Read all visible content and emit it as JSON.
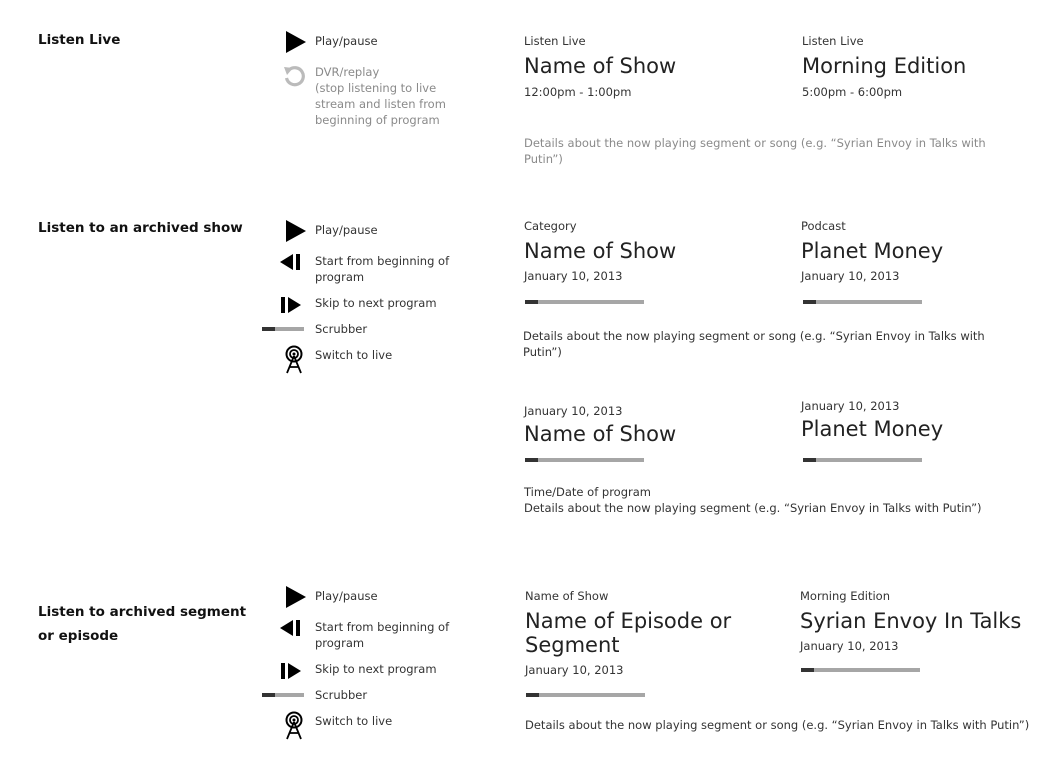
{
  "sections": {
    "live": {
      "title": "Listen Live"
    },
    "archived_show": {
      "title": "Listen to an archived show"
    },
    "archived_segment": {
      "title_line1": "Listen to archived segment",
      "title_line2": "or episode"
    }
  },
  "legend": {
    "play_pause": "Play/pause",
    "dvr_line1": "DVR/replay",
    "dvr_line2": "(stop listening to live",
    "dvr_line3": "stream and listen from",
    "dvr_line4": "beginning of program",
    "start_line1": "Start from beginning of",
    "start_line2": "program",
    "skip": "Skip to next program",
    "scrubber": "Scrubber",
    "switch_live": "Switch to live"
  },
  "live_cards": [
    {
      "label": "Listen Live",
      "title": "Name of Show",
      "time": "12:00pm - 1:00pm"
    },
    {
      "label": "Listen Live",
      "title": "Morning Edition",
      "time": "5:00pm - 6:00pm"
    }
  ],
  "live_details": "Details about the now playing segment or song (e.g. “Syrian Envoy in Talks with Putin”)",
  "archived_cards": [
    {
      "label": "Category",
      "title": "Name of Show",
      "date": "January 10, 2013",
      "progress": 0.11
    },
    {
      "label": "Podcast",
      "title": "Planet Money",
      "date": "January 10, 2013",
      "progress": 0.11
    }
  ],
  "archived_details": "Details about the now playing segment or song (e.g. “Syrian Envoy in Talks with Putin”)",
  "archived_alt_cards": [
    {
      "date": "January 10, 2013",
      "title": "Name of Show",
      "progress": 0.11
    },
    {
      "date": "January 10, 2013",
      "title": "Planet Money",
      "progress": 0.11
    }
  ],
  "archived_alt_details": {
    "line1": "Time/Date of program",
    "line2": "Details about the now playing segment (e.g. “Syrian Envoy in Talks with Putin”)"
  },
  "segment_cards": [
    {
      "label": "Name of Show",
      "title_line1": "Name of Episode or",
      "title_line2": "Segment",
      "date": "January 10, 2013",
      "progress": 0.11
    },
    {
      "label": "Morning Edition",
      "title_line1": "Syrian Envoy In Talks",
      "date": "January 10, 2013",
      "progress": 0.11
    }
  ],
  "segment_details": "Details about the now playing segment or song (e.g. “Syrian Envoy in Talks with Putin”)",
  "icons": [
    "play-icon",
    "replay-icon",
    "start-from-beginning-icon",
    "skip-next-icon",
    "scrubber-icon",
    "live-antenna-icon"
  ]
}
